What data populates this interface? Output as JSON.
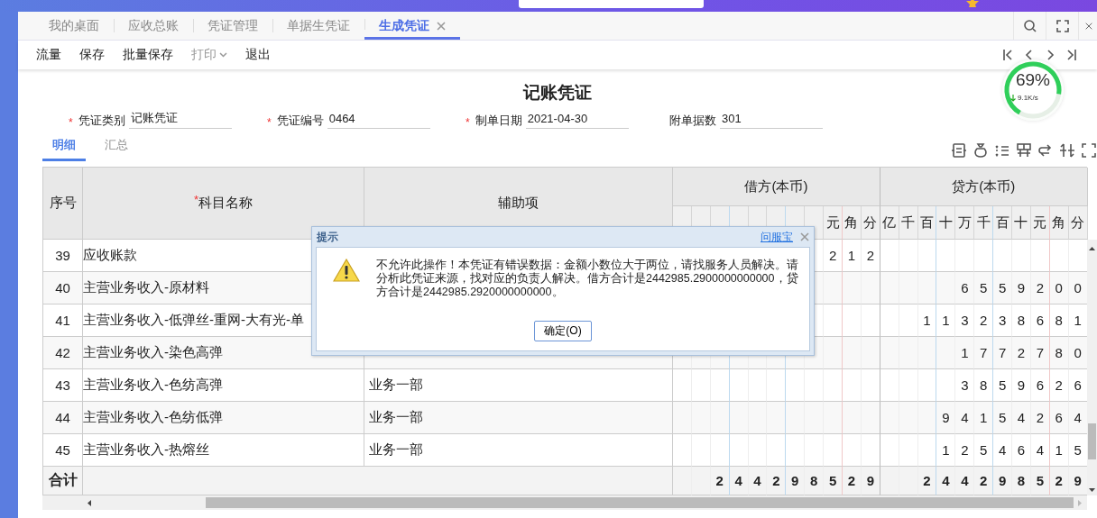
{
  "tabs": [
    {
      "label": "我的桌面",
      "selected": false
    },
    {
      "label": "应收总账",
      "selected": false
    },
    {
      "label": "凭证管理",
      "selected": false
    },
    {
      "label": "单据生凭证",
      "selected": false
    },
    {
      "label": "生成凭证",
      "selected": true
    }
  ],
  "toolbar": [
    {
      "label": "流量",
      "disabled": false
    },
    {
      "label": "保存",
      "disabled": false
    },
    {
      "label": "批量保存",
      "disabled": false
    },
    {
      "label": "打印",
      "disabled": true,
      "has_menu": true
    },
    {
      "label": "退出",
      "disabled": false
    }
  ],
  "title": "记账凭证",
  "fields": [
    {
      "mark": "*",
      "label": "凭证类别",
      "value": "记账凭证"
    },
    {
      "mark": "*",
      "label": "凭证编号",
      "value": "0464"
    },
    {
      "mark": "*",
      "label": "制单日期",
      "value": "2021-04-30"
    },
    {
      "label": "附单据数",
      "value": "301"
    }
  ],
  "subtabs": [
    {
      "label": "明细",
      "selected": true
    },
    {
      "label": "汇总",
      "selected": false
    }
  ],
  "table": {
    "columns": [
      {
        "label": "序号"
      },
      {
        "mark": "*",
        "label": "科目名称"
      },
      {
        "label": "辅助项"
      }
    ],
    "debit_header": "借方(本币)",
    "credit_header": "贷方(本币)",
    "debit_units": [
      "元",
      "角",
      "分"
    ],
    "credit_units": [
      "亿",
      "千",
      "百",
      "十",
      "万",
      "千",
      "百",
      "十",
      "元",
      "角",
      "分"
    ],
    "rows": [
      {
        "no": "39",
        "subject": "应收账款",
        "debit": [
          "2",
          "1",
          "2"
        ]
      },
      {
        "no": "40",
        "subject": "主营业务收入-原材料",
        "credit": [
          "6",
          "5",
          "5",
          "9",
          "2",
          "0",
          "0"
        ]
      },
      {
        "no": "41",
        "subject": "主营业务收入-低弹丝-重网-大有光-单",
        "credit": [
          "1",
          "1",
          "3",
          "2",
          "3",
          "8",
          "6",
          "8",
          "1"
        ]
      },
      {
        "no": "42",
        "subject": "主营业务收入-染色高弹",
        "credit": [
          "1",
          "7",
          "7",
          "2",
          "7",
          "8",
          "0"
        ]
      },
      {
        "no": "43",
        "subject": "主营业务收入-色纺高弹",
        "aux": "业务一部",
        "credit": [
          "3",
          "8",
          "5",
          "9",
          "6",
          "2",
          "6"
        ]
      },
      {
        "no": "44",
        "subject": "主营业务收入-色纺低弹",
        "aux": "业务一部",
        "credit": [
          "9",
          "4",
          "1",
          "5",
          "4",
          "2",
          "6",
          "4"
        ]
      },
      {
        "no": "45",
        "subject": "主营业务收入-热熔丝",
        "aux": "业务一部",
        "credit": [
          "1",
          "2",
          "5",
          "4",
          "6",
          "4",
          "1",
          "5"
        ]
      }
    ],
    "totals": {
      "label": "合计",
      "debit": [
        "2",
        "4",
        "4",
        "2",
        "9",
        "8",
        "5",
        "2",
        "9"
      ],
      "credit": [
        "2",
        "4",
        "4",
        "2",
        "9",
        "8",
        "5",
        "2",
        "9"
      ]
    }
  },
  "dialog": {
    "title": "提示",
    "link": "问服宝",
    "message": "不允许此操作！本凭证有错误数据：金额小数位大于两位，请找服务人员解决。请分析此凭证来源，找对应的负责人解决。借方合计是2442985.2900000000000，贷方合计是2442985.2920000000000。",
    "button": "确定(O)"
  },
  "speed_widget": {
    "percent": "69%",
    "rate": "9.1K/s",
    "level": 0.69
  }
}
